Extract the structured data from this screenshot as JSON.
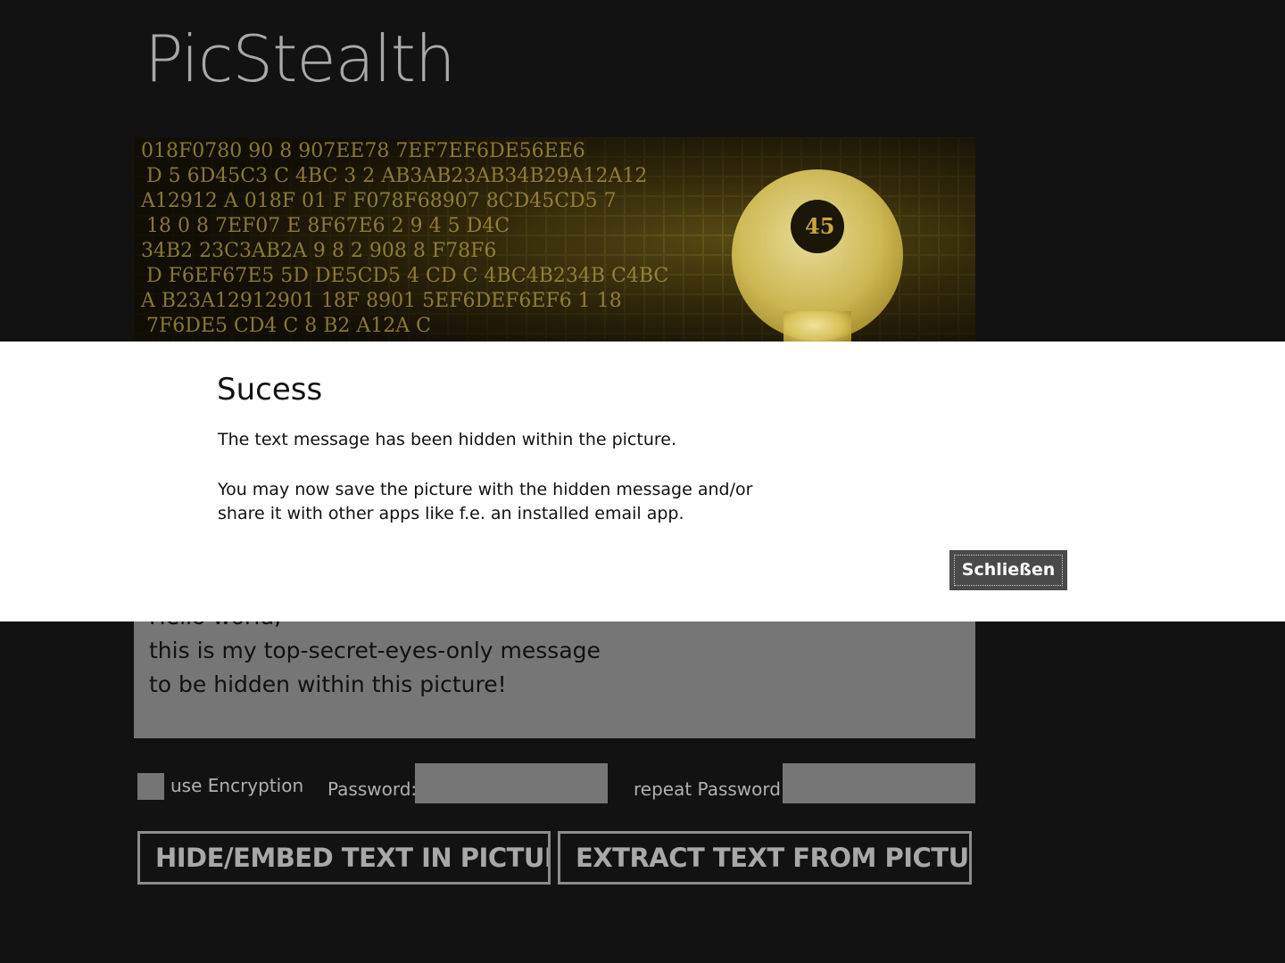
{
  "app": {
    "title": "PicStealth"
  },
  "banner": {
    "image": "hex-code-key-image",
    "rows": [
      "018F0780  90 8 907EE78 7EF7EF6DE56EE6",
      "D 5 6D45C3 C 4BC 3 2 AB3AB23AB34B29A12A12",
      "A12912 A 018F 01 F F078F68907 8CD45CD5 7",
      "18 0 8 7EF07 E 8F67E6 2 9 4 5 D4C",
      "34B2 23C3AB2A 9 8 2 908 8 F78F6",
      "D F6EF67E5 5D DE5CD5 4 CD C 4BC4B234B C4BC",
      "A B23A12912901 18F 8901 5EF6DEF6EF6 1 18",
      "7F6DE5 CD4 C 8 B2 A12A C"
    ],
    "key_hex": "45"
  },
  "message": {
    "lines": [
      "Hello world,",
      "this is my top-secret-eyes-only message",
      "to be hidden within this picture!"
    ]
  },
  "options": {
    "checkbox_label": "use Encryption",
    "password_label": "Password:",
    "repeat_password_label": "repeat Password:",
    "password_value": "",
    "repeat_password_value": ""
  },
  "actions": {
    "hide_label": "HIDE/EMBED TEXT IN PICTURE",
    "extract_label": "EXTRACT TEXT FROM PICTURE"
  },
  "dialog": {
    "title": "Sucess",
    "paragraph1": "The text message has been hidden within the picture.",
    "paragraph2": "You may now save the picture with the hidden message and/or share it with other apps like f.e. an installed email app.",
    "close_label": "Schließen"
  },
  "colors": {
    "background": "#121212",
    "dialog_background": "#ffffff",
    "input_gray": "#767676",
    "text_gray": "#a8a8a8",
    "button_dark": "#4a4a4a",
    "banner_gold": "#c9a83a"
  }
}
